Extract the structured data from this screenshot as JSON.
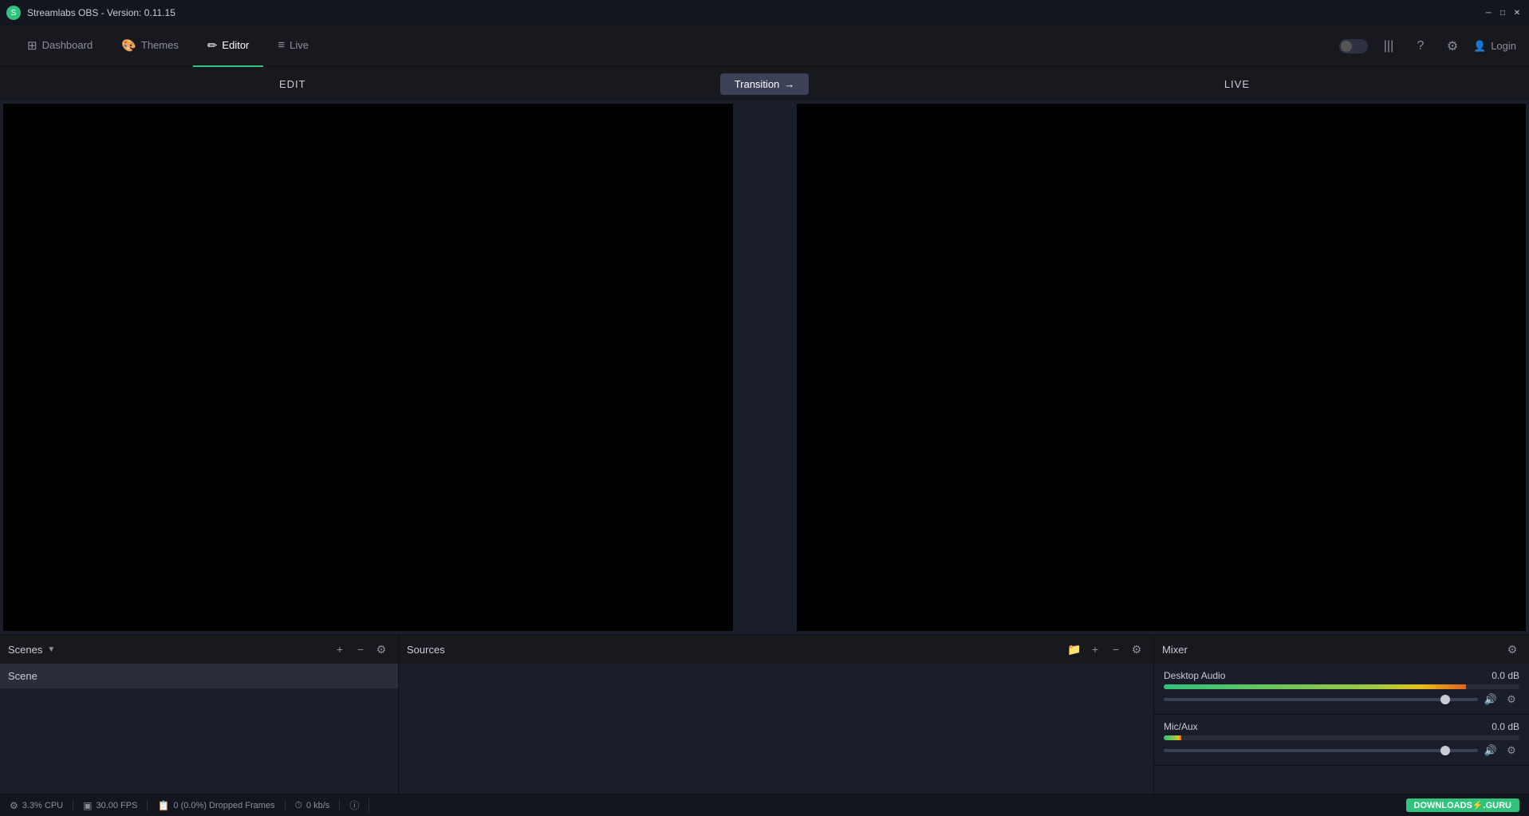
{
  "titlebar": {
    "title": "Streamlabs OBS - Version: 0.11.15",
    "app_icon": "S"
  },
  "window_controls": {
    "minimize": "─",
    "maximize": "□",
    "close": "✕"
  },
  "nav": {
    "items": [
      {
        "id": "dashboard",
        "label": "Dashboard",
        "icon": "⊞"
      },
      {
        "id": "themes",
        "label": "Themes",
        "icon": "🎨"
      },
      {
        "id": "editor",
        "label": "Editor",
        "icon": "✏"
      },
      {
        "id": "live",
        "label": "Live",
        "icon": "≡"
      }
    ],
    "active": "editor",
    "toggle_icon": "🌐",
    "bars_icon": "|||",
    "help_icon": "?",
    "settings_icon": "⚙",
    "login_icon": "👤",
    "login_label": "Login"
  },
  "studio": {
    "edit_label": "EDIT",
    "live_label": "LIVE",
    "transition_label": "Transition",
    "transition_arrow": "→"
  },
  "scenes": {
    "title": "Scenes",
    "items": [
      {
        "name": "Scene",
        "active": true
      }
    ],
    "add_label": "+",
    "remove_label": "−",
    "settings_label": "⚙"
  },
  "sources": {
    "title": "Sources",
    "items": [],
    "folder_label": "📁",
    "add_label": "+",
    "remove_label": "−",
    "settings_label": "⚙"
  },
  "mixer": {
    "title": "Mixer",
    "settings_label": "⚙",
    "channels": [
      {
        "name": "Desktop Audio",
        "db": "0.0 dB",
        "volume_pct": 85,
        "slider_pct": 88
      },
      {
        "name": "Mic/Aux",
        "db": "0.0 dB",
        "volume_pct": 5,
        "slider_pct": 88
      }
    ]
  },
  "statusbar": {
    "cpu_icon": "⚙",
    "cpu_label": "3.3% CPU",
    "fps_icon": "▣",
    "fps_label": "30.00 FPS",
    "dropped_icon": "📋",
    "dropped_label": "0 (0.0%) Dropped Frames",
    "network_icon": "⏱",
    "network_label": "0 kb/s",
    "info_icon": "ⓘ",
    "downloads_label": "DOWNLOADS",
    "downloads_sub": "⚡.GURU"
  }
}
